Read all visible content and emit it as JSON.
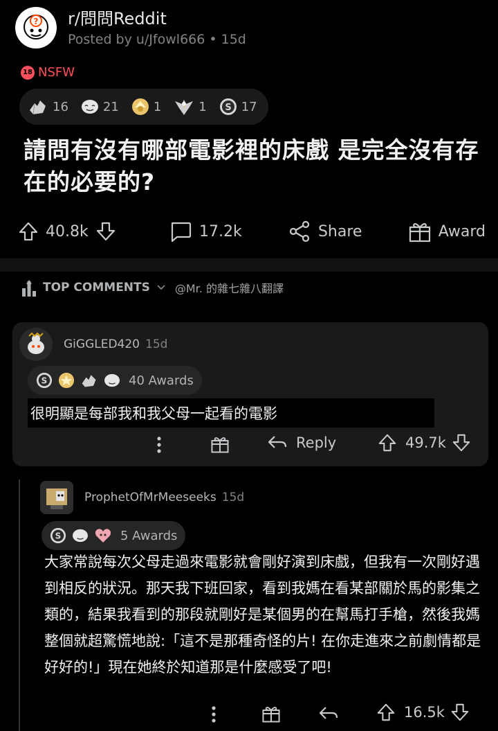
{
  "post": {
    "subreddit": "r/問問Reddit",
    "posted_by": "Posted by u/Jfowl666 • 15d",
    "nsfw_badge": "18",
    "nsfw_label": "NSFW",
    "title": "請問有沒有哪部電影裡的床戲 是完全沒有存在的必要的?",
    "awards": [
      {
        "icon": "hand-award-icon",
        "count": "16"
      },
      {
        "icon": "tearing-up-award-icon",
        "count": "21"
      },
      {
        "icon": "helpful-award-icon",
        "count": "1"
      },
      {
        "icon": "eagle-award-icon",
        "count": "1"
      },
      {
        "icon": "silver-award-icon",
        "count": "17"
      }
    ],
    "actions": {
      "votes": "40.8k",
      "comments": "17.2k",
      "share": "Share",
      "award": "Award"
    }
  },
  "sort": {
    "label": "TOP COMMENTS",
    "credit": "@Mr. 的雜七雜八翻譯"
  },
  "comments": [
    {
      "user": "GiGGLED420",
      "time": "15d",
      "awards_label": "40 Awards",
      "text": "很明顯是每部我和我父母一起看的電影",
      "reply": "Reply",
      "votes": "49.7k"
    },
    {
      "user": "ProphetOfMrMeeseeks",
      "time": "15d",
      "awards_label": "5 Awards",
      "text": "大家常說每次父母走過來電影就會剛好演到床戲，但我有一次剛好遇到相反的狀況。那天我下班回家，看到我媽在看某部關於馬的影集之類的，結果我看到的那段就剛好是某個男的在幫馬打手槍，然後我媽整個就超驚慌地說:「這不是那種奇怪的片! 在你走進來之前劇情都是好好的!」現在她終於知道那是什麼感受了吧!",
      "votes": "16.5k"
    }
  ],
  "colors": {
    "background": "#000000",
    "card": "#1a1a1b",
    "nsfw": "#ff4f5a",
    "text": "#d7dadc",
    "muted": "#818384"
  }
}
